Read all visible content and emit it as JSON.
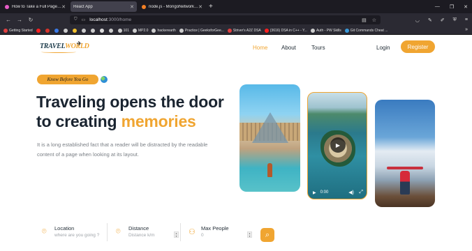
{
  "browser": {
    "tabs": [
      {
        "title": "How to Take a Full Page Screens",
        "active": false
      },
      {
        "title": "React App",
        "active": true
      },
      {
        "title": "node.js - MongoNetworkError: co",
        "active": false
      }
    ],
    "url_host": "localhost",
    "url_path": ":3000/home",
    "bookmarks": [
      "Getting Started",
      "101",
      "MP2.0",
      "hackerearth",
      "Practice | GeeksforGee...",
      "Striver's A2Z DSA",
      "(3616) DSA in C++ - Y...",
      "Auth - PW Skills",
      "Git Commands Cheat ..."
    ]
  },
  "header": {
    "logo_travel": "TRAVEL",
    "logo_world": "WORLD",
    "nav": [
      "Home",
      "About",
      "Tours"
    ],
    "login": "Login",
    "register": "Register"
  },
  "hero": {
    "badge": "Know Before You Go",
    "title_line1": "Traveling opens the door",
    "title_line2_prefix": "to creating ",
    "title_highlight": "memories",
    "description": "It is a long established fact that a reader will be distracted by the readable content of a page when looking at its layout."
  },
  "video": {
    "time": "0:00"
  },
  "search": {
    "location_label": "Location",
    "location_placeholder": "where are you going ?",
    "distance_label": "Distance",
    "distance_placeholder": "Distance k/m",
    "maxpeople_label": "Max People",
    "maxpeople_placeholder": "0"
  },
  "colors": {
    "accent": "#f0a531",
    "heading": "#1a2430"
  },
  "icons": {
    "location": "map-pin-icon",
    "distance": "map-pin-icon",
    "people": "people-icon",
    "search": "search-icon"
  }
}
